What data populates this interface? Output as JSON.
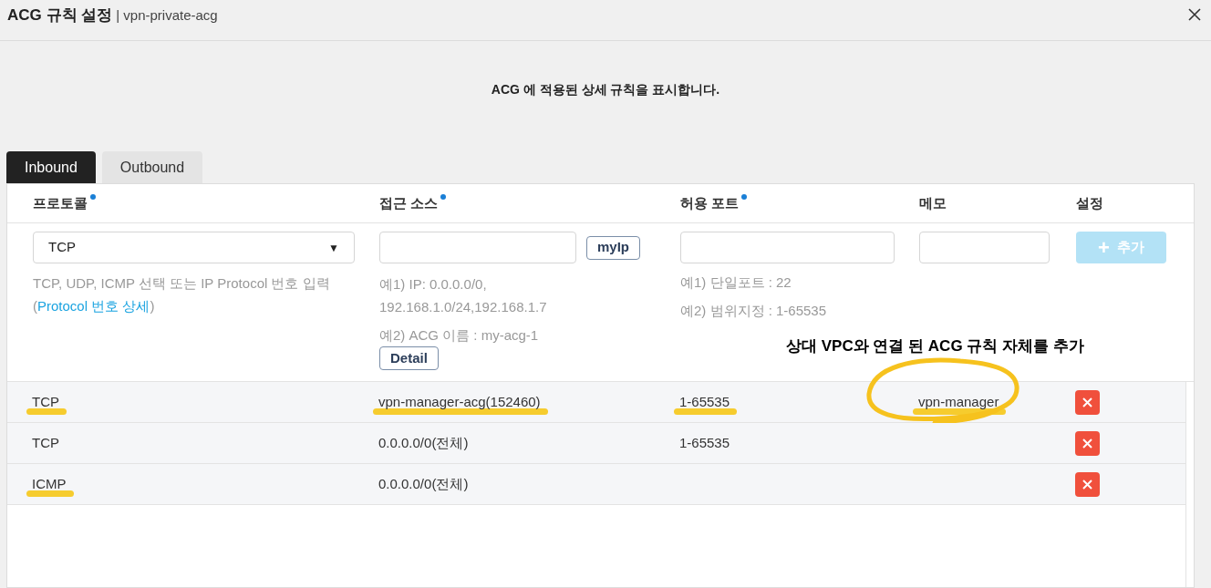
{
  "window": {
    "title": "ACG 규칙 설정",
    "subtitle": "| vpn-private-acg"
  },
  "description": "ACG 에 적용된 상세 규칙을 표시합니다.",
  "tabs": [
    {
      "label": "Inbound",
      "selected": true
    },
    {
      "label": "Outbound",
      "selected": false
    }
  ],
  "table": {
    "columns": [
      {
        "label": "프로토콜",
        "required": true
      },
      {
        "label": "접근 소스",
        "required": true
      },
      {
        "label": "허용 포트",
        "required": true
      },
      {
        "label": "메모",
        "required": false
      },
      {
        "label": "설정",
        "required": false
      }
    ],
    "form": {
      "protocol_select": {
        "value": "TCP",
        "caret": "▼"
      },
      "protocol_help": "TCP, UDP, ICMP 선택 또는 IP Protocol 번호 입력",
      "protocol_link_open": "(",
      "protocol_link": "Protocol 번호 상세",
      "protocol_link_close": ")",
      "myip_button": "myIp",
      "source_help": [
        "예1) IP: 0.0.0.0/0,\n192.168.1.0/24,192.168.1.7",
        "예2) ACG 이름 : my-acg-1"
      ],
      "detail_button": "Detail",
      "port_help": [
        "예1) 단일포트 : 22",
        "예2) 범위지정 : 1-65535"
      ],
      "add_button": {
        "icon": "+",
        "label": "추가",
        "disabled": true
      }
    },
    "rows": [
      {
        "protocol": {
          "text": "TCP",
          "highlighted": true
        },
        "source": {
          "text": "vpn-manager-acg(152460)",
          "highlighted": true
        },
        "port": {
          "text": "1-65535",
          "highlighted": true
        },
        "memo": {
          "text": "vpn-manager",
          "highlighted": true
        },
        "circled": true
      },
      {
        "protocol": {
          "text": "TCP",
          "highlighted": false
        },
        "source": {
          "text": "0.0.0.0/0(전체)",
          "highlighted": false
        },
        "port": {
          "text": "1-65535",
          "highlighted": false
        },
        "circled": false
      },
      {
        "protocol": {
          "text": "ICMP",
          "highlighted": true
        },
        "source": {
          "text": "0.0.0.0/0(전체)",
          "highlighted": false
        },
        "circled": false
      }
    ]
  },
  "annotation": "상대 VPC와 연결 된 ACG 규칙 자체를 추가"
}
